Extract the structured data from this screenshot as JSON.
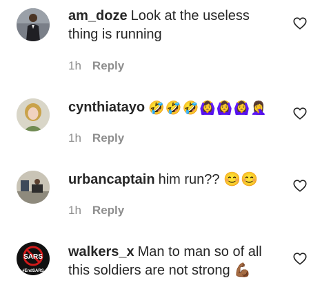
{
  "comments": [
    {
      "username": "am_doze",
      "text": "Look at the useless thing is running",
      "time": "1h",
      "reply_label": "Reply",
      "avatar_icon": "person-dark-suit-photo"
    },
    {
      "username": "cynthiatayo",
      "text": "🤣🤣🤣🙆‍♀️🙆‍♀️🙆‍♀️🤦‍♀️",
      "time": "1h",
      "reply_label": "Reply",
      "avatar_icon": "woman-portrait-photo"
    },
    {
      "username": "urbancaptain",
      "text": "him run?? 😊😊",
      "time": "1h",
      "reply_label": "Reply",
      "avatar_icon": "room-scene-photo"
    },
    {
      "username": "walkers_x",
      "text": "Man to man so of all this soldiers are not strong 💪🏾",
      "time": "",
      "reply_label": "",
      "avatar_icon": "end-sars-logo",
      "avatar_logo_text": "SARS",
      "avatar_logo_subtext": "#EndSARS"
    }
  ],
  "colors": {
    "text": "#262626",
    "meta": "#8e8e8e",
    "heart_stroke": "#262626"
  },
  "icons": {
    "like": "heart-outline-icon"
  }
}
